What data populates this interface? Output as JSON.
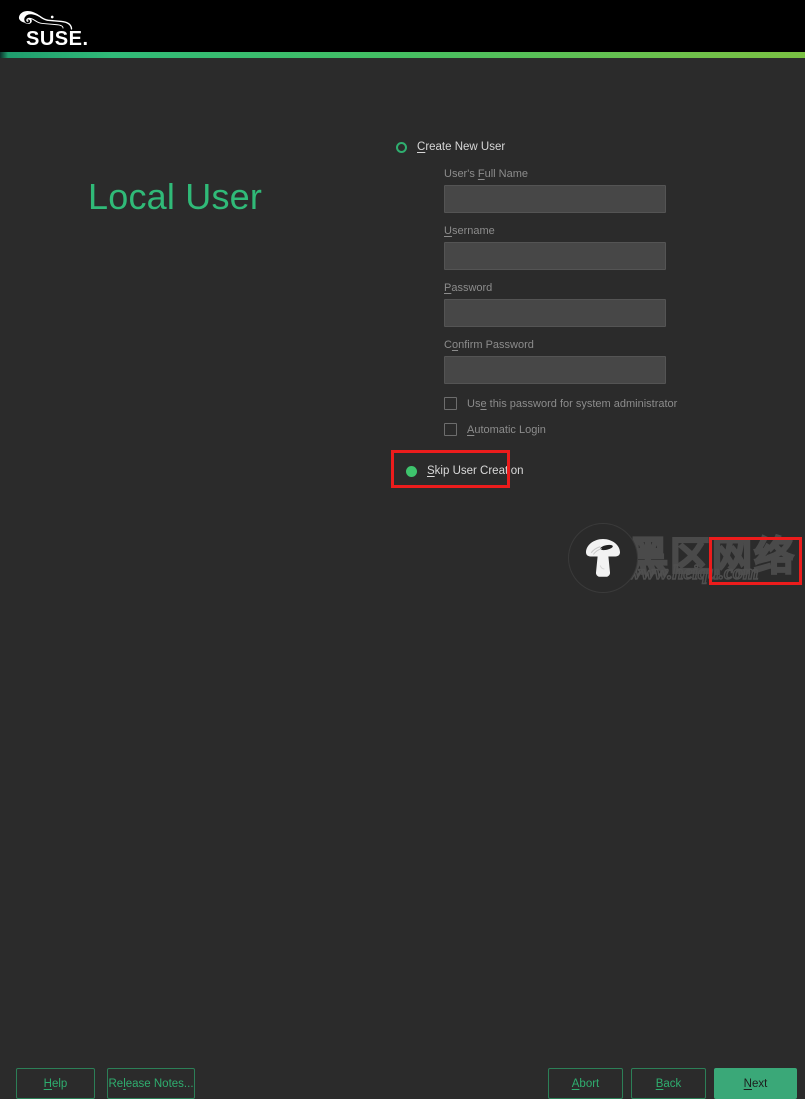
{
  "header": {
    "logo_name": "suse-chameleon-logo",
    "logo_text": "SUSE.",
    "background": "#000000"
  },
  "accent_bar": {
    "color_start": "#30ba78",
    "color_end": "#7ac143"
  },
  "page": {
    "title": "Local User",
    "title_color": "#30ba78",
    "background": "#2b2b2b"
  },
  "form": {
    "create_user_radio": {
      "label": "Create New User",
      "mnemonic": "C",
      "selected": false
    },
    "fields": [
      {
        "label_pre": "User's ",
        "mnemonic": "F",
        "label_post": "ull Name",
        "value": "",
        "placeholder": "",
        "disabled": true,
        "type": "text"
      },
      {
        "label_pre": "",
        "mnemonic": "U",
        "label_post": "sername",
        "value": "",
        "placeholder": "",
        "disabled": true,
        "type": "text"
      },
      {
        "label_pre": "",
        "mnemonic": "P",
        "label_post": "assword",
        "value": "",
        "placeholder": "",
        "disabled": true,
        "type": "password"
      },
      {
        "label_pre": "C",
        "mnemonic": "o",
        "label_post": "nfirm Password",
        "value": "",
        "placeholder": "",
        "disabled": true,
        "type": "password"
      }
    ],
    "checkboxes": [
      {
        "label_pre": "Us",
        "mnemonic": "e",
        "label_post": " this password for system administrator",
        "checked": false,
        "disabled": true
      },
      {
        "label_pre": "",
        "mnemonic": "A",
        "label_post": "utomatic Login",
        "checked": false,
        "disabled": true
      }
    ],
    "skip_user_radio": {
      "label": "Skip User Creation",
      "mnemonic": "S",
      "selected": true
    }
  },
  "annotations": [
    {
      "name": "skip-user-creation",
      "color": "#ec1c1c"
    },
    {
      "name": "next-button",
      "color": "#ec1c1c"
    }
  ],
  "footer": {
    "buttons": [
      {
        "id": "help",
        "label_pre": "",
        "mnemonic": "H",
        "label_post": "elp",
        "style": "ghost"
      },
      {
        "id": "relnotes",
        "label_pre": "Re",
        "mnemonic": "l",
        "label_post": "ease Notes...",
        "style": "ghost"
      },
      {
        "id": "abort",
        "label_pre": "",
        "mnemonic": "A",
        "label_post": "bort",
        "style": "ghost"
      },
      {
        "id": "back",
        "label_pre": "",
        "mnemonic": "B",
        "label_post": "ack",
        "style": "ghost"
      },
      {
        "id": "next",
        "label_pre": "",
        "mnemonic": "N",
        "label_post": "ext",
        "style": "primary"
      }
    ]
  },
  "overlay": {
    "cursor_icon": "mushroom-cursor-icon",
    "watermark_cjk": "黑区网络",
    "watermark_url": "www.heiqu.com"
  }
}
